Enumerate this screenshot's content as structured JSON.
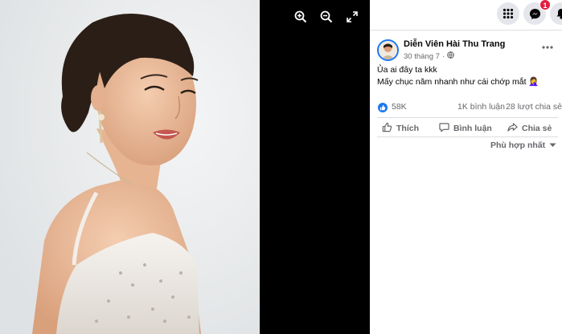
{
  "viewer": {
    "tools": [
      {
        "name": "zoom-in-icon"
      },
      {
        "name": "zoom-out-icon"
      },
      {
        "name": "fullscreen-icon"
      }
    ]
  },
  "topbar": {
    "menu_icon": "grid-menu-icon",
    "messenger_icon": "messenger-icon",
    "notification_badge": "1",
    "notifications_icon": "bell-icon"
  },
  "post": {
    "author": "Diễn Viên Hài Thu Trang",
    "date": "30 tháng 7",
    "separator": "·",
    "privacy_icon": "globe-icon",
    "text_lines": [
      "Ủa ai đây ta kkk",
      "Mấy chục năm nhanh như cái chớp mắt 🤦‍♀️"
    ],
    "reactions": {
      "count": "58K",
      "icon": "like-icon"
    },
    "comments": "1K bình luận",
    "shares": "28 lượt chia sẻ",
    "actions": {
      "like": "Thích",
      "comment": "Bình luận",
      "share": "Chia sẻ"
    },
    "sort_label": "Phù hợp nhất"
  },
  "colors": {
    "brand_blue": "#1877f2",
    "secondary_text": "#65676b",
    "primary_text": "#050505",
    "badge_red": "#e41e3f",
    "viewer_bg": "#000000"
  }
}
